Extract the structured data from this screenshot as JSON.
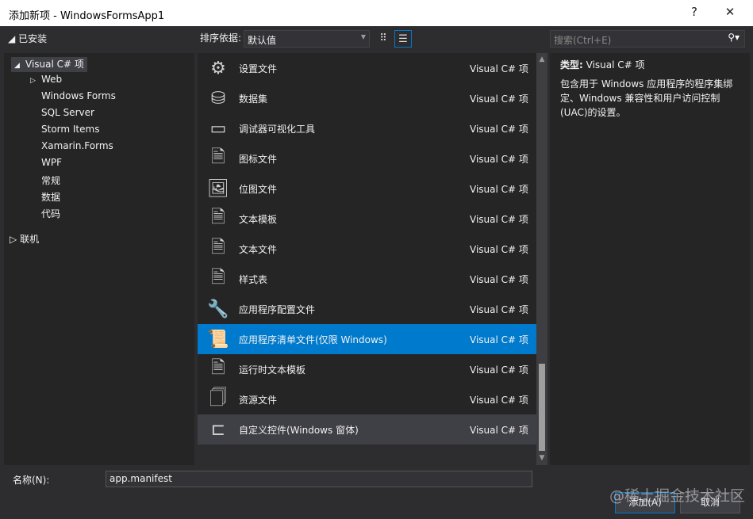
{
  "window": {
    "title": "添加新项 - WindowsFormsApp1",
    "help": "?",
    "close": "✕"
  },
  "tree": {
    "installed": "已安装",
    "items": [
      {
        "label": "Visual C# 项",
        "arrow": "◢",
        "level": 1
      },
      {
        "label": "Web",
        "arrow": "▷",
        "level": 2
      },
      {
        "label": "Windows Forms",
        "arrow": "",
        "level": 2
      },
      {
        "label": "SQL Server",
        "arrow": "",
        "level": 2
      },
      {
        "label": "Storm Items",
        "arrow": "",
        "level": 2
      },
      {
        "label": "Xamarin.Forms",
        "arrow": "",
        "level": 2
      },
      {
        "label": "WPF",
        "arrow": "",
        "level": 2
      },
      {
        "label": "常规",
        "arrow": "",
        "level": 2
      },
      {
        "label": "数据",
        "arrow": "",
        "level": 2
      },
      {
        "label": "代码",
        "arrow": "",
        "level": 2
      }
    ],
    "online": "联机"
  },
  "sort": {
    "label": "排序依据:",
    "value": "默认值"
  },
  "search": {
    "placeholder": "搜索(Ctrl+E)"
  },
  "items": [
    {
      "name": "设置文件",
      "type": "Visual C# 项",
      "icon": "⚙"
    },
    {
      "name": "数据集",
      "type": "Visual C# 项",
      "icon": "⛁"
    },
    {
      "name": "调试器可视化工具",
      "type": "Visual C# 项",
      "icon": "▭"
    },
    {
      "name": "图标文件",
      "type": "Visual C# 项",
      "icon": "🗎"
    },
    {
      "name": "位图文件",
      "type": "Visual C# 项",
      "icon": "🖼"
    },
    {
      "name": "文本模板",
      "type": "Visual C# 项",
      "icon": "🗎"
    },
    {
      "name": "文本文件",
      "type": "Visual C# 项",
      "icon": "🗎"
    },
    {
      "name": "样式表",
      "type": "Visual C# 项",
      "icon": "🗎"
    },
    {
      "name": "应用程序配置文件",
      "type": "Visual C# 项",
      "icon": "🔧"
    },
    {
      "name": "应用程序清单文件(仅限 Windows)",
      "type": "Visual C# 项",
      "icon": "📜"
    },
    {
      "name": "运行时文本模板",
      "type": "Visual C# 项",
      "icon": "🗎"
    },
    {
      "name": "资源文件",
      "type": "Visual C# 项",
      "icon": "🗍"
    },
    {
      "name": "自定义控件(Windows 窗体)",
      "type": "Visual C# 项",
      "icon": "⊏"
    }
  ],
  "details": {
    "type_label": "类型:",
    "type_value": "Visual C# 项",
    "description": "包含用于 Windows 应用程序的程序集绑定、Windows 兼容性和用户访问控制(UAC)的设置。"
  },
  "footer": {
    "name_label": "名称(N):",
    "name_value": "app.manifest",
    "add": "添加(A)",
    "cancel": "取消"
  },
  "watermark": "@稀土掘金技术社区"
}
